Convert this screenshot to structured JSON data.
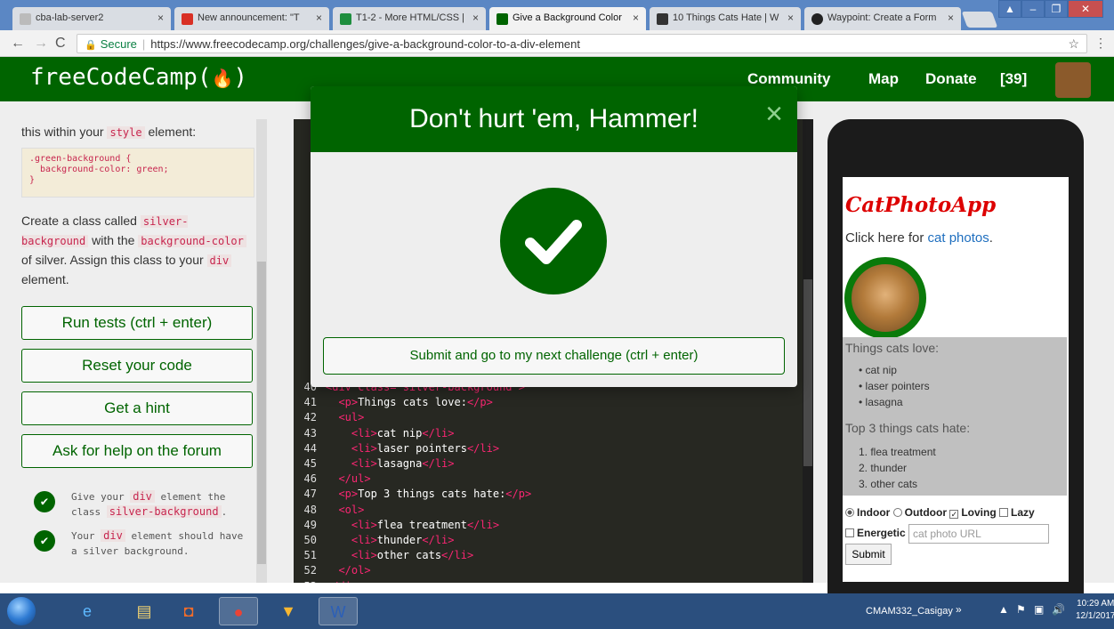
{
  "browser": {
    "tabs": [
      {
        "label": "cba-lab-server2",
        "favicon_color": "#bbbbbb"
      },
      {
        "label": "New announcement: \"T",
        "favicon_color": "#d93025"
      },
      {
        "label": "T1-2 - More HTML/CSS |",
        "favicon_color": "#1e8e3e"
      },
      {
        "label": "Give a Background Color",
        "favicon_color": "#006400"
      },
      {
        "label": "10 Things Cats Hate | W",
        "favicon_color": "#333333"
      },
      {
        "label": "Waypoint: Create a Form",
        "favicon_color": "#222222"
      }
    ],
    "secure_label": "Secure",
    "url": "https://www.freecodecamp.org/challenges/give-a-background-color-to-a-div-element"
  },
  "nav": {
    "logo": "freeCodeCamp(🔥)",
    "logo_text": "freeCodeCamp",
    "community": "Community",
    "map": "Map",
    "donate": "Donate",
    "points": "[39]"
  },
  "left": {
    "intro_pre": "this within your",
    "intro_code": "style",
    "intro_post": "element:",
    "codeblock": ".green-background {\n  background-color: green;\n}",
    "p1": "Create a class called",
    "p1_code": "silver-background",
    "p1_mid": "with the",
    "p1_code2": "background-color",
    "p1_post": "of silver. Assign this class to your",
    "p1_code3": "div",
    "p1_end": "element.",
    "run_tests": "Run tests (ctrl + enter)",
    "reset": "Reset your code",
    "hint": "Get a hint",
    "forum": "Ask for help on the forum",
    "test1": "Give your div element the class silver-background.",
    "test1_a": "Give your",
    "test1_code": "div",
    "test1_b": "element the class",
    "test1_code2": "silver-background",
    "test2_a": "Your",
    "test2_code": "div",
    "test2_b": "element should have a silver background."
  },
  "editor": {
    "lines": [
      {
        "n": "40",
        "parts": [
          {
            "t": "<div class=\"silver-background\">",
            "c": "tag"
          }
        ]
      },
      {
        "n": "41",
        "parts": [
          {
            "t": "  <p>",
            "c": "tag"
          },
          {
            "t": "Things cats love:",
            "c": "txt"
          },
          {
            "t": "</p>",
            "c": "tag"
          }
        ]
      },
      {
        "n": "42",
        "parts": [
          {
            "t": "  <ul>",
            "c": "tag"
          }
        ]
      },
      {
        "n": "43",
        "parts": [
          {
            "t": "    <li>",
            "c": "tag"
          },
          {
            "t": "cat nip",
            "c": "txt"
          },
          {
            "t": "</li>",
            "c": "tag"
          }
        ]
      },
      {
        "n": "44",
        "parts": [
          {
            "t": "    <li>",
            "c": "tag"
          },
          {
            "t": "laser pointers",
            "c": "txt"
          },
          {
            "t": "</li>",
            "c": "tag"
          }
        ]
      },
      {
        "n": "45",
        "parts": [
          {
            "t": "    <li>",
            "c": "tag"
          },
          {
            "t": "lasagna",
            "c": "txt"
          },
          {
            "t": "</li>",
            "c": "tag"
          }
        ]
      },
      {
        "n": "46",
        "parts": [
          {
            "t": "  </ul>",
            "c": "tag"
          }
        ]
      },
      {
        "n": "47",
        "parts": [
          {
            "t": "  <p>",
            "c": "tag"
          },
          {
            "t": "Top 3 things cats hate:",
            "c": "txt"
          },
          {
            "t": "</p>",
            "c": "tag"
          }
        ]
      },
      {
        "n": "48",
        "parts": [
          {
            "t": "  <ol>",
            "c": "tag"
          }
        ]
      },
      {
        "n": "49",
        "parts": [
          {
            "t": "    <li>",
            "c": "tag"
          },
          {
            "t": "flea treatment",
            "c": "txt"
          },
          {
            "t": "</li>",
            "c": "tag"
          }
        ]
      },
      {
        "n": "50",
        "parts": [
          {
            "t": "    <li>",
            "c": "tag"
          },
          {
            "t": "thunder",
            "c": "txt"
          },
          {
            "t": "</li>",
            "c": "tag"
          }
        ]
      },
      {
        "n": "51",
        "parts": [
          {
            "t": "    <li>",
            "c": "tag"
          },
          {
            "t": "other cats",
            "c": "txt"
          },
          {
            "t": "</li>",
            "c": "tag"
          }
        ]
      },
      {
        "n": "52",
        "parts": [
          {
            "t": "  </ol>",
            "c": "tag"
          }
        ]
      },
      {
        "n": "53",
        "parts": [
          {
            "t": "</div>",
            "c": "tag"
          }
        ]
      }
    ]
  },
  "preview": {
    "title": "CatPhotoApp",
    "click_pre": "Click here for",
    "click_link": "cat photos",
    "click_post": ".",
    "love_title": "Things cats love:",
    "love": [
      "cat nip",
      "laser pointers",
      "lasagna"
    ],
    "hate_title": "Top 3 things cats hate:",
    "hate": [
      "flea treatment",
      "thunder",
      "other cats"
    ],
    "radio_indoor": "Indoor",
    "radio_outdoor": "Outdoor",
    "cb_loving": "Loving",
    "cb_lazy": "Lazy",
    "cb_energetic": "Energetic",
    "url_placeholder": "cat photo URL",
    "submit": "Submit"
  },
  "modal": {
    "title": "Don't hurt 'em, Hammer!",
    "close": "×",
    "submit": "Submit and go to my next challenge (ctrl + enter)"
  },
  "taskbar": {
    "user": "CMAM332_Casigay",
    "time": "10:29 AM",
    "date": "12/1/2017"
  },
  "colors": {
    "fcc_green": "#006400",
    "editor_bg": "#272822",
    "tag_pink": "#f92672",
    "title_red": "#dd0000"
  }
}
